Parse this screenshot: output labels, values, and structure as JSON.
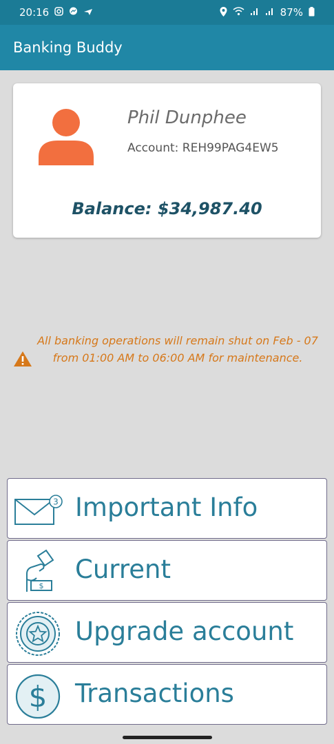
{
  "status_bar": {
    "time": "20:16",
    "battery": "87%",
    "left_icons": [
      "instagram-icon",
      "messenger-icon",
      "airplane-notification-icon"
    ],
    "right_icons": [
      "location-icon",
      "wifi-icon",
      "signal-icon",
      "signal-icon",
      "battery-icon"
    ]
  },
  "app_bar": {
    "title": "Banking Buddy"
  },
  "profile": {
    "name": "Phil Dunphee",
    "account_label": "Account: REH99PAG4EW5",
    "balance_label": "Balance: $34,987.40",
    "avatar_icon": "person-icon"
  },
  "notice": {
    "icon": "warning-icon",
    "text": "All banking operations will remain shut on Feb - 07 from 01:00 AM to 06:00 AM for maintenance."
  },
  "menu": [
    {
      "label": "Important Info",
      "icon": "mail-badge-icon",
      "badge": "3"
    },
    {
      "label": "Current",
      "icon": "deposit-hand-icon"
    },
    {
      "label": "Upgrade account",
      "icon": "star-seal-icon"
    },
    {
      "label": "Transactions",
      "icon": "dollar-circle-icon"
    }
  ],
  "colors": {
    "app_bar": "#2087a6",
    "status_bar": "#1b7b96",
    "avatar": "#f26f3f",
    "notice": "#d6781a",
    "button_text": "#2a7e99",
    "balance": "#1e5266"
  }
}
